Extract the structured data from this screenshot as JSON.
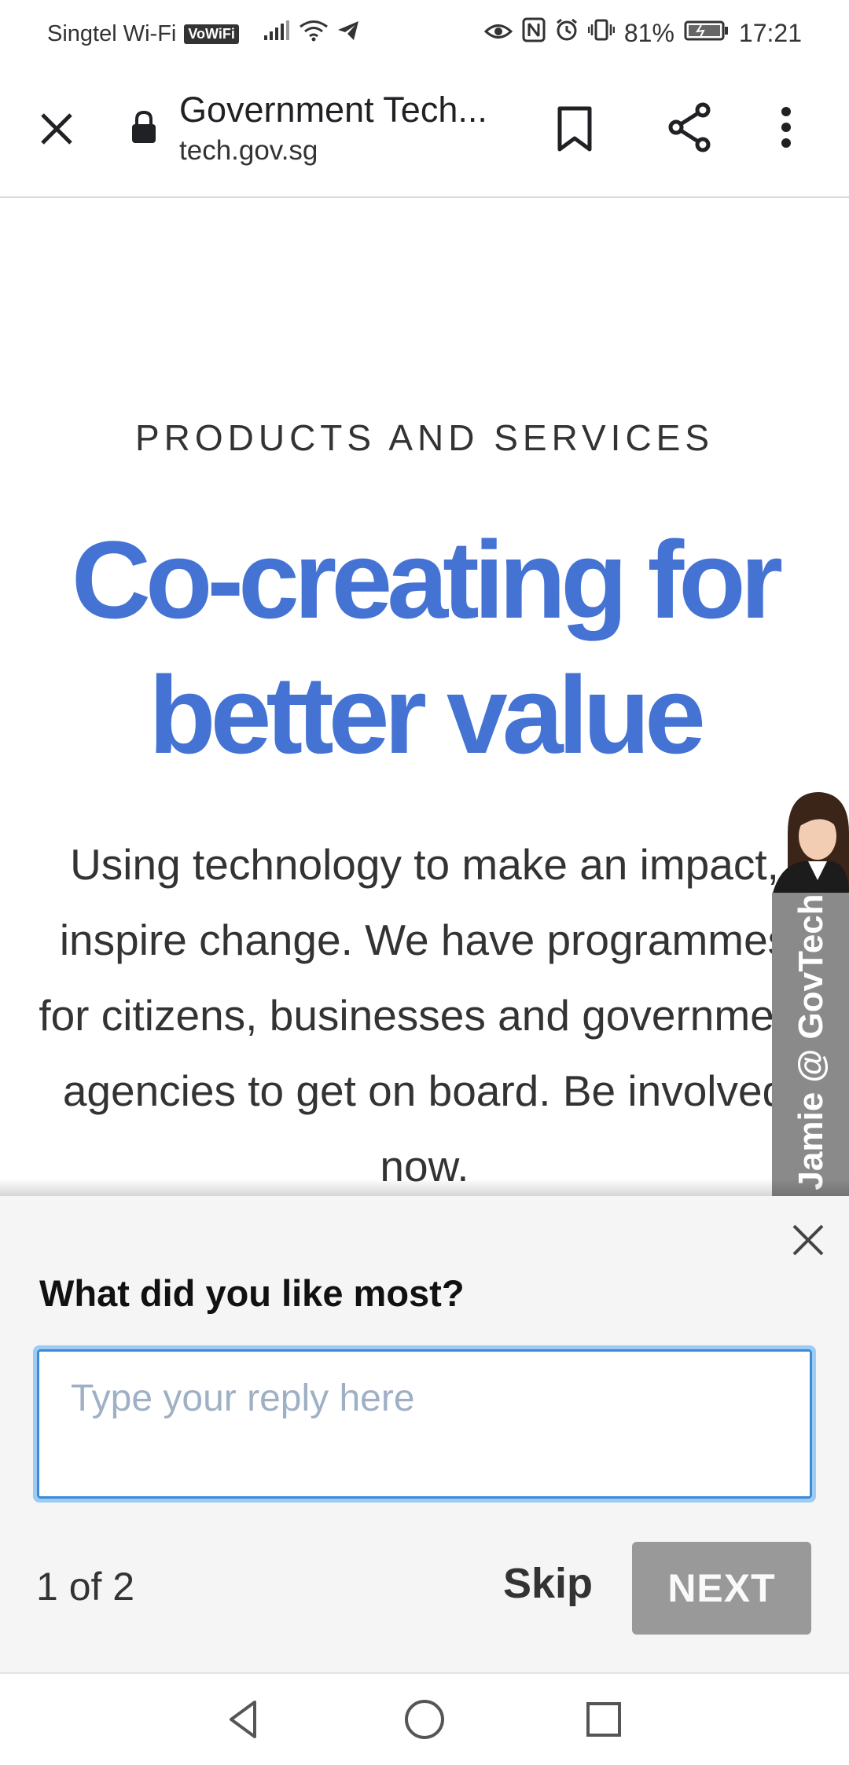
{
  "status_bar": {
    "carrier": "Singtel Wi-Fi",
    "vowifi_badge": "VoWiFi",
    "battery": "81%",
    "time": "17:21"
  },
  "toolbar": {
    "page_title": "Government Tech...",
    "url": "tech.gov.sg"
  },
  "content": {
    "eyebrow": "PRODUCTS AND SERVICES",
    "headline_line1": "Co-creating for",
    "headline_line2": "better value",
    "lede": "Using technology to make an impact, inspire change. We have programmes for citizens, businesses and government agencies to get on board. Be involved now."
  },
  "chat_widget": {
    "label": "Jamie @ GovTech"
  },
  "survey": {
    "question": "What did you like most?",
    "reply_placeholder": "Type your reply here",
    "reply_value": "",
    "step": "1 of 2",
    "skip_label": "Skip",
    "next_label": "NEXT"
  },
  "colors": {
    "headline": "#4473d4",
    "next_button": "#999999",
    "input_focus_ring": "#9ccbf3"
  }
}
